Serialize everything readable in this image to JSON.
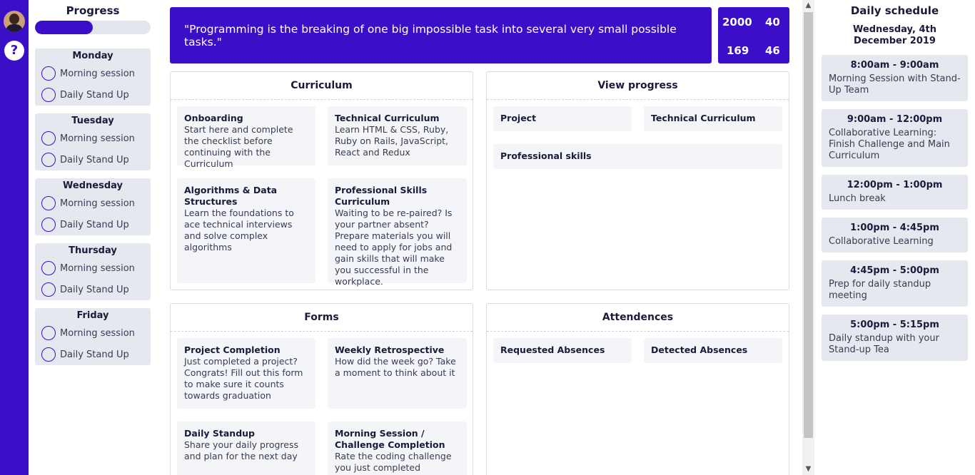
{
  "progress": {
    "title": "Progress",
    "fill_fraction": 0.5,
    "days": [
      {
        "name": "Monday",
        "sessions": [
          "Morning session",
          "Daily Stand Up"
        ]
      },
      {
        "name": "Tuesday",
        "sessions": [
          "Morning session",
          "Daily Stand Up"
        ]
      },
      {
        "name": "Wednesday",
        "sessions": [
          "Morning session",
          "Daily Stand Up"
        ]
      },
      {
        "name": "Thursday",
        "sessions": [
          "Morning session",
          "Daily Stand Up"
        ]
      },
      {
        "name": "Friday",
        "sessions": [
          "Morning session",
          "Daily Stand Up"
        ]
      }
    ]
  },
  "quote": "\"Programming is the breaking of one big impossible task into several very small possible tasks.\"",
  "stats": [
    "2000",
    "40",
    "169",
    "46"
  ],
  "curriculum": {
    "title": "Curriculum",
    "cards": [
      {
        "title": "Onboarding",
        "desc": "Start here and complete the checklist before continuing with the Curriculum"
      },
      {
        "title": "Technical Curriculum",
        "desc": "Learn HTML & CSS, Ruby, Ruby on Rails, JavaScript, React and Redux"
      },
      {
        "title": "Algorithms & Data Structures",
        "desc": "Learn the foundations to ace technical interviews and solve complex algorithms"
      },
      {
        "title": "Professional Skills Curriculum",
        "desc": "Waiting to be re-paired? Is your partner absent? Prepare materials you will need to apply for jobs and gain skills that will make you successful in the workplace."
      }
    ]
  },
  "view_progress": {
    "title": "View progress",
    "cards": [
      "Project",
      "Technical Curriculum",
      "Professional skills"
    ]
  },
  "forms": {
    "title": "Forms",
    "cards": [
      {
        "title": "Project Completion",
        "desc": "Just completed a project? Congrats! Fill out this form to make sure it counts towards graduation"
      },
      {
        "title": "Weekly Retrospective",
        "desc": "How did the week go? Take a moment to think about it"
      },
      {
        "title": "Daily Standup",
        "desc": "Share your daily progress and plan for the next day"
      },
      {
        "title": "Morning Session / Challenge Completion",
        "desc": "Rate the coding challenge you just completed"
      }
    ]
  },
  "attendences": {
    "title": "Attendences",
    "cards": [
      "Requested Absences",
      "Detected Absences"
    ]
  },
  "schedule": {
    "title": "Daily schedule",
    "date": "Wednesday, 4th December 2019",
    "slots": [
      {
        "time": "8:00am - 9:00am",
        "desc": "Morning Session with Stand-Up Team"
      },
      {
        "time": "9:00am - 12:00pm",
        "desc": "Collaborative Learning: Finish Challenge and Main Curriculum"
      },
      {
        "time": "12:00pm - 1:00pm",
        "desc": "Lunch break"
      },
      {
        "time": "1:00pm - 4:45pm",
        "desc": "Collaborative Learning"
      },
      {
        "time": "4:45pm - 5:00pm",
        "desc": "Prep for daily standup meeting"
      },
      {
        "time": "5:00pm - 5:15pm",
        "desc": "Daily standup with your Stand-up Tea"
      }
    ]
  },
  "icons": {
    "help": "?",
    "scroll_up": "▲",
    "scroll_down": "▼"
  },
  "colors": {
    "accent": "#3a0fc7",
    "card_bg": "#f4f5f8",
    "day_bg": "#e6e8ef"
  }
}
